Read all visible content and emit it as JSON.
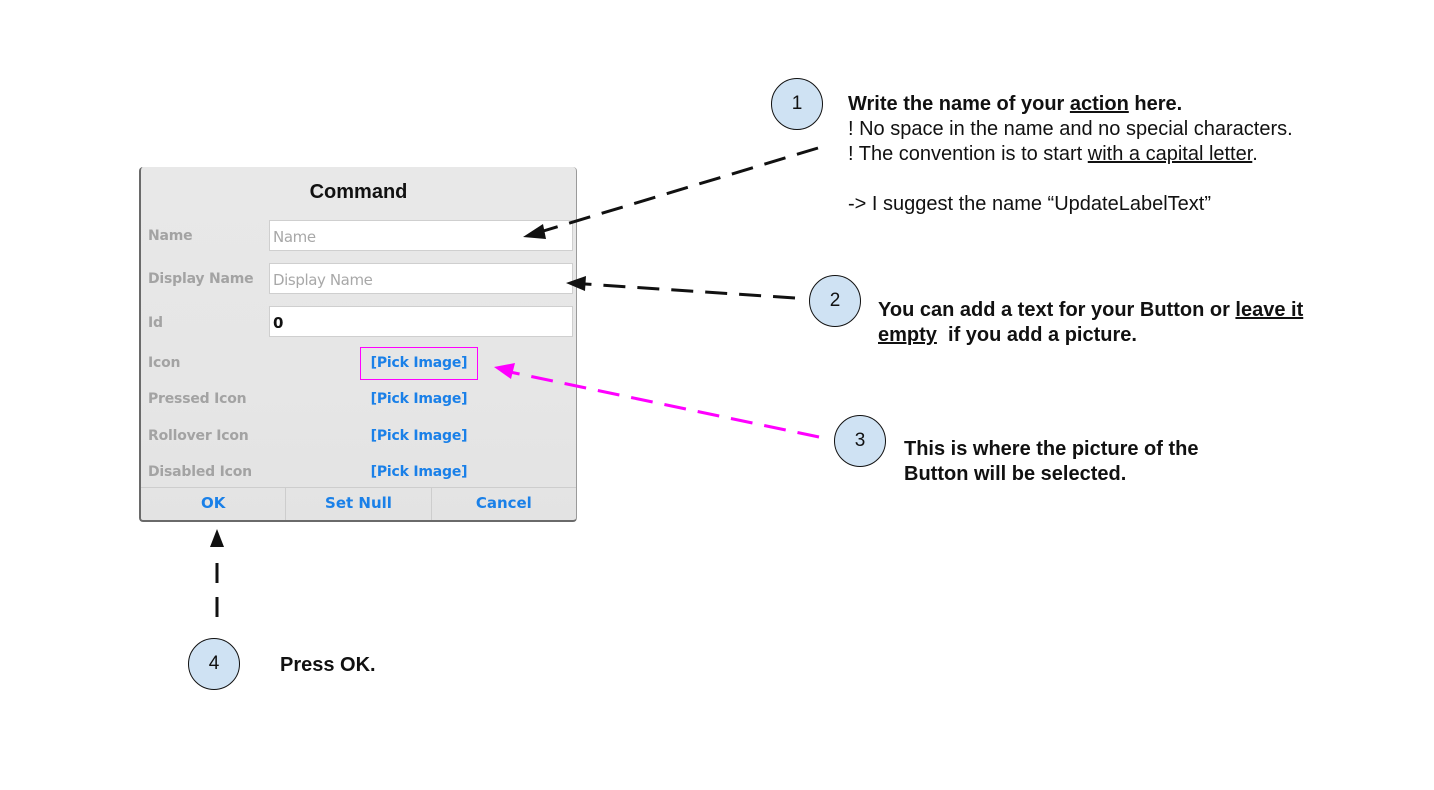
{
  "dialog": {
    "title": "Command",
    "fields": [
      {
        "label": "Name",
        "placeholder": "Name",
        "value": ""
      },
      {
        "label": "Display Name",
        "placeholder": "Display Name",
        "value": ""
      },
      {
        "label": "Id",
        "placeholder": "",
        "value": "0"
      }
    ],
    "image_rows": [
      {
        "label": "Icon",
        "action": "[Pick Image]"
      },
      {
        "label": "Pressed Icon",
        "action": "[Pick Image]"
      },
      {
        "label": "Rollover Icon",
        "action": "[Pick Image]"
      },
      {
        "label": "Disabled Icon",
        "action": "[Pick Image]"
      }
    ],
    "buttons": {
      "ok": "OK",
      "set_null": "Set Null",
      "cancel": "Cancel"
    }
  },
  "callouts": [
    {
      "number": "1",
      "heading_pre": "Write the name of your ",
      "heading_underlined": "action",
      "heading_post": " here.",
      "line2": "! No space in the name and no special characters.",
      "line3_pre": "! The convention is to start ",
      "line3_underlined": "with a capital letter",
      "line3_post": ".",
      "line4": "-> I suggest the name “UpdateLabelText”"
    },
    {
      "number": "2",
      "line1_pre": "You can add a text for your Button or ",
      "line1_underlined": "leave it",
      "line2_underlined": "empty",
      "line2_post": "  if you add a picture."
    },
    {
      "number": "3",
      "line1": "This is where the picture of the",
      "line2": "Button will be selected."
    },
    {
      "number": "4",
      "line1": "Press OK."
    }
  ],
  "colors": {
    "link_blue": "#1a80e8",
    "highlight_magenta": "#ff00ff",
    "circle_fill": "#cfe2f3",
    "label_gray": "#a3a3a3"
  }
}
